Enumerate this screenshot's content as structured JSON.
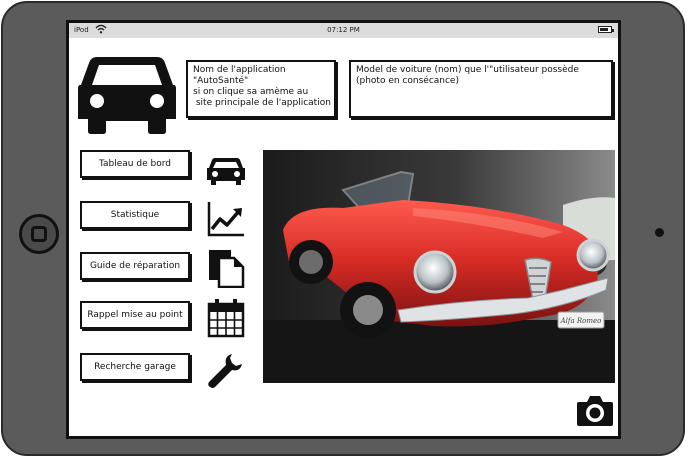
{
  "statusbar": {
    "carrier": "iPod",
    "time": "07:12 PM",
    "wifi_icon": "wifi-icon",
    "battery_icon": "battery-icon"
  },
  "header": {
    "logo_icon": "car-icon",
    "app_note_lines": [
      "Nom de l'application",
      "\"AutoSanté\"",
      "si on clique sa amème au",
      " site principale de l'application"
    ],
    "car_note_lines": [
      "Model de voiture (nom) que l'\"utilisateur possède",
      "(photo en consécance)"
    ]
  },
  "menu": {
    "items": [
      {
        "label": "Tableau de bord",
        "icon": "car-icon"
      },
      {
        "label": "Statistique",
        "icon": "chart-trend-icon"
      },
      {
        "label": "Guide de réparation",
        "icon": "document-icon"
      },
      {
        "label": "Rappel mise au point",
        "icon": "calendar-icon"
      },
      {
        "label": "Recherche garage",
        "icon": "wrench-icon"
      }
    ]
  },
  "photo": {
    "badge_text": "Alfa Romeo"
  },
  "actions": {
    "camera_icon": "camera-icon"
  },
  "colors": {
    "frame": "#5b5b5b",
    "car_red": "#d42a24",
    "ink": "#111111"
  }
}
